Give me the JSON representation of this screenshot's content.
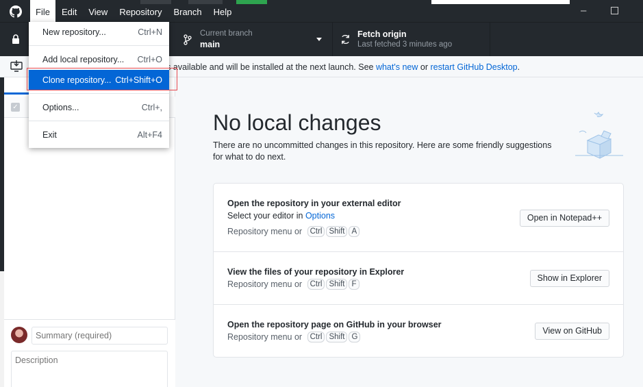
{
  "menubar": {
    "items": [
      "File",
      "Edit",
      "View",
      "Repository",
      "Branch",
      "Help"
    ],
    "open_item": "File"
  },
  "toolbar": {
    "branch_label": "Current branch",
    "branch_value": "main",
    "fetch_title": "Fetch origin",
    "fetch_label": "Last fetched 3 minutes ago"
  },
  "banner": {
    "text_prefix": "p is available and will be installed at the next launch. See ",
    "link_whats_new": "what's new",
    "text_or": " or ",
    "link_restart": "restart GitHub Desktop",
    "text_suffix": "."
  },
  "file_menu": {
    "items": [
      {
        "label": "New repository...",
        "shortcut": "Ctrl+N"
      },
      {
        "label": "Add local repository...",
        "shortcut": "Ctrl+O"
      },
      {
        "label": "Clone repository...",
        "shortcut": "Ctrl+Shift+O"
      },
      {
        "label": "Options...",
        "shortcut": "Ctrl+,"
      },
      {
        "label": "Exit",
        "shortcut": "Alt+F4"
      }
    ]
  },
  "commit": {
    "summary_placeholder": "Summary (required)",
    "description_placeholder": "Description"
  },
  "main": {
    "title": "No local changes",
    "subtitle": "There are no uncommitted changes in this repository. Here are some friendly suggestions for what to do next.",
    "suggestions": [
      {
        "title": "Open the repository in your external editor",
        "desc_prefix": "Select your editor in ",
        "desc_link": "Options",
        "hint_prefix": "Repository menu or",
        "keys": [
          "Ctrl",
          "Shift",
          "A"
        ],
        "button": "Open in Notepad++"
      },
      {
        "title": "View the files of your repository in Explorer",
        "hint_prefix": "Repository menu or",
        "keys": [
          "Ctrl",
          "Shift",
          "F"
        ],
        "button": "Show in Explorer"
      },
      {
        "title": "Open the repository page on GitHub in your browser",
        "hint_prefix": "Repository menu or",
        "keys": [
          "Ctrl",
          "Shift",
          "G"
        ],
        "button": "View on GitHub"
      }
    ]
  },
  "colors": {
    "accent": "#0366d6",
    "titlebar": "#24292e",
    "highlight_box": "#e5484d"
  }
}
